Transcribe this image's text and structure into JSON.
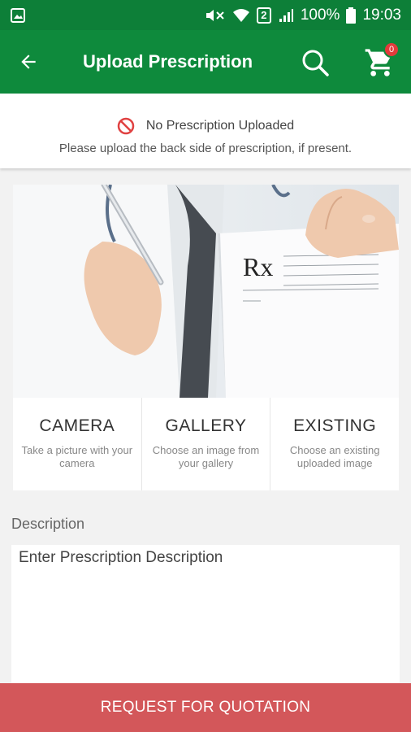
{
  "status_bar": {
    "battery": "100%",
    "time": "19:03",
    "sim_label": "2"
  },
  "appbar": {
    "title": "Upload Prescription",
    "cart_count": "0"
  },
  "notice": {
    "status": "No Prescription Uploaded",
    "hint": "Please upload the back side of prescription, if present."
  },
  "hero": {
    "rx_symbol": "Rx"
  },
  "options": [
    {
      "title": "CAMERA",
      "subtitle": "Take a picture with your camera"
    },
    {
      "title": "GALLERY",
      "subtitle": "Choose an image from your gallery"
    },
    {
      "title": "EXISTING",
      "subtitle": "Choose an existing uploaded image"
    }
  ],
  "description": {
    "label": "Description",
    "placeholder": "Enter Prescription Description"
  },
  "cta": {
    "label": "REQUEST FOR QUOTATION"
  },
  "colors": {
    "primary": "#0e8a3c",
    "status_bar": "#0d7f38",
    "cta": "#d3575a",
    "badge": "#e23b3b",
    "no_icon": "#e04141"
  }
}
